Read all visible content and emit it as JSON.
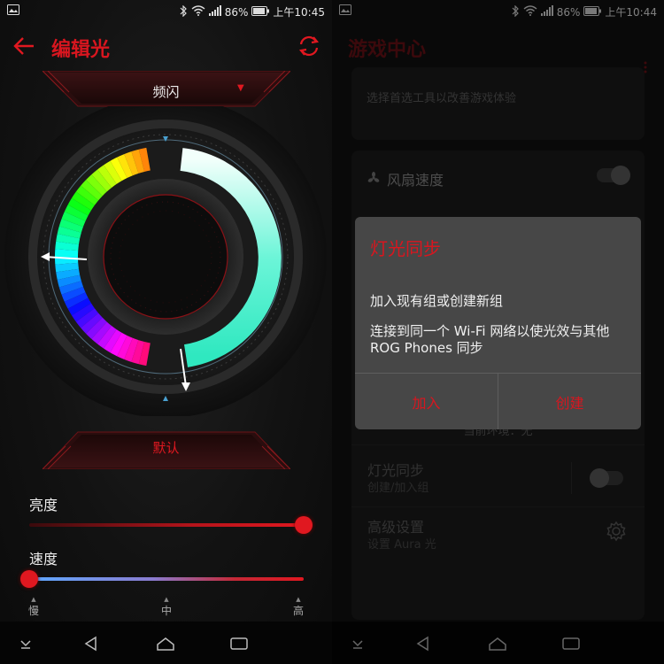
{
  "left": {
    "status": {
      "battery": "86%",
      "time": "上午10:45"
    },
    "title": "编辑光",
    "mode": {
      "label": "频闪"
    },
    "default_label": "默认",
    "brightness": {
      "label": "亮度",
      "value": 1.0
    },
    "speed": {
      "label": "速度",
      "value": 0.0,
      "ticks": [
        "慢",
        "中",
        "高"
      ]
    },
    "colors": {
      "accent": "#e01820"
    }
  },
  "right": {
    "status": {
      "battery": "86%",
      "time": "上午10:44"
    },
    "title": "游戏中心",
    "card1_text": "选择首选工具以改善游戏体验",
    "fan_label": "风扇速度",
    "bg_status": "当前环境：无",
    "light_sync": {
      "title": "灯光同步",
      "sub": "创建/加入组"
    },
    "advanced": {
      "title": "高级设置",
      "sub": "设置 Aura 光"
    },
    "dialog": {
      "title": "灯光同步",
      "subtitle": "加入现有组或创建新组",
      "body": "连接到同一个 Wi-Fi 网络以使光效与其他 ROG Phones 同步",
      "join": "加入",
      "create": "创建"
    }
  }
}
